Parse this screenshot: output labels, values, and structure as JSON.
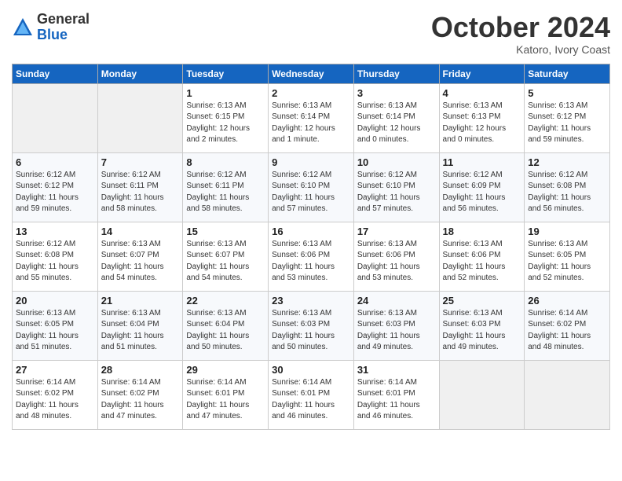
{
  "header": {
    "logo_general": "General",
    "logo_blue": "Blue",
    "month_title": "October 2024",
    "location": "Katoro, Ivory Coast"
  },
  "days_of_week": [
    "Sunday",
    "Monday",
    "Tuesday",
    "Wednesday",
    "Thursday",
    "Friday",
    "Saturday"
  ],
  "weeks": [
    [
      {
        "day": "",
        "info": ""
      },
      {
        "day": "",
        "info": ""
      },
      {
        "day": "1",
        "info": "Sunrise: 6:13 AM\nSunset: 6:15 PM\nDaylight: 12 hours\nand 2 minutes."
      },
      {
        "day": "2",
        "info": "Sunrise: 6:13 AM\nSunset: 6:14 PM\nDaylight: 12 hours\nand 1 minute."
      },
      {
        "day": "3",
        "info": "Sunrise: 6:13 AM\nSunset: 6:14 PM\nDaylight: 12 hours\nand 0 minutes."
      },
      {
        "day": "4",
        "info": "Sunrise: 6:13 AM\nSunset: 6:13 PM\nDaylight: 12 hours\nand 0 minutes."
      },
      {
        "day": "5",
        "info": "Sunrise: 6:13 AM\nSunset: 6:12 PM\nDaylight: 11 hours\nand 59 minutes."
      }
    ],
    [
      {
        "day": "6",
        "info": "Sunrise: 6:12 AM\nSunset: 6:12 PM\nDaylight: 11 hours\nand 59 minutes."
      },
      {
        "day": "7",
        "info": "Sunrise: 6:12 AM\nSunset: 6:11 PM\nDaylight: 11 hours\nand 58 minutes."
      },
      {
        "day": "8",
        "info": "Sunrise: 6:12 AM\nSunset: 6:11 PM\nDaylight: 11 hours\nand 58 minutes."
      },
      {
        "day": "9",
        "info": "Sunrise: 6:12 AM\nSunset: 6:10 PM\nDaylight: 11 hours\nand 57 minutes."
      },
      {
        "day": "10",
        "info": "Sunrise: 6:12 AM\nSunset: 6:10 PM\nDaylight: 11 hours\nand 57 minutes."
      },
      {
        "day": "11",
        "info": "Sunrise: 6:12 AM\nSunset: 6:09 PM\nDaylight: 11 hours\nand 56 minutes."
      },
      {
        "day": "12",
        "info": "Sunrise: 6:12 AM\nSunset: 6:08 PM\nDaylight: 11 hours\nand 56 minutes."
      }
    ],
    [
      {
        "day": "13",
        "info": "Sunrise: 6:12 AM\nSunset: 6:08 PM\nDaylight: 11 hours\nand 55 minutes."
      },
      {
        "day": "14",
        "info": "Sunrise: 6:13 AM\nSunset: 6:07 PM\nDaylight: 11 hours\nand 54 minutes."
      },
      {
        "day": "15",
        "info": "Sunrise: 6:13 AM\nSunset: 6:07 PM\nDaylight: 11 hours\nand 54 minutes."
      },
      {
        "day": "16",
        "info": "Sunrise: 6:13 AM\nSunset: 6:06 PM\nDaylight: 11 hours\nand 53 minutes."
      },
      {
        "day": "17",
        "info": "Sunrise: 6:13 AM\nSunset: 6:06 PM\nDaylight: 11 hours\nand 53 minutes."
      },
      {
        "day": "18",
        "info": "Sunrise: 6:13 AM\nSunset: 6:06 PM\nDaylight: 11 hours\nand 52 minutes."
      },
      {
        "day": "19",
        "info": "Sunrise: 6:13 AM\nSunset: 6:05 PM\nDaylight: 11 hours\nand 52 minutes."
      }
    ],
    [
      {
        "day": "20",
        "info": "Sunrise: 6:13 AM\nSunset: 6:05 PM\nDaylight: 11 hours\nand 51 minutes."
      },
      {
        "day": "21",
        "info": "Sunrise: 6:13 AM\nSunset: 6:04 PM\nDaylight: 11 hours\nand 51 minutes."
      },
      {
        "day": "22",
        "info": "Sunrise: 6:13 AM\nSunset: 6:04 PM\nDaylight: 11 hours\nand 50 minutes."
      },
      {
        "day": "23",
        "info": "Sunrise: 6:13 AM\nSunset: 6:03 PM\nDaylight: 11 hours\nand 50 minutes."
      },
      {
        "day": "24",
        "info": "Sunrise: 6:13 AM\nSunset: 6:03 PM\nDaylight: 11 hours\nand 49 minutes."
      },
      {
        "day": "25",
        "info": "Sunrise: 6:13 AM\nSunset: 6:03 PM\nDaylight: 11 hours\nand 49 minutes."
      },
      {
        "day": "26",
        "info": "Sunrise: 6:14 AM\nSunset: 6:02 PM\nDaylight: 11 hours\nand 48 minutes."
      }
    ],
    [
      {
        "day": "27",
        "info": "Sunrise: 6:14 AM\nSunset: 6:02 PM\nDaylight: 11 hours\nand 48 minutes."
      },
      {
        "day": "28",
        "info": "Sunrise: 6:14 AM\nSunset: 6:02 PM\nDaylight: 11 hours\nand 47 minutes."
      },
      {
        "day": "29",
        "info": "Sunrise: 6:14 AM\nSunset: 6:01 PM\nDaylight: 11 hours\nand 47 minutes."
      },
      {
        "day": "30",
        "info": "Sunrise: 6:14 AM\nSunset: 6:01 PM\nDaylight: 11 hours\nand 46 minutes."
      },
      {
        "day": "31",
        "info": "Sunrise: 6:14 AM\nSunset: 6:01 PM\nDaylight: 11 hours\nand 46 minutes."
      },
      {
        "day": "",
        "info": ""
      },
      {
        "day": "",
        "info": ""
      }
    ]
  ]
}
